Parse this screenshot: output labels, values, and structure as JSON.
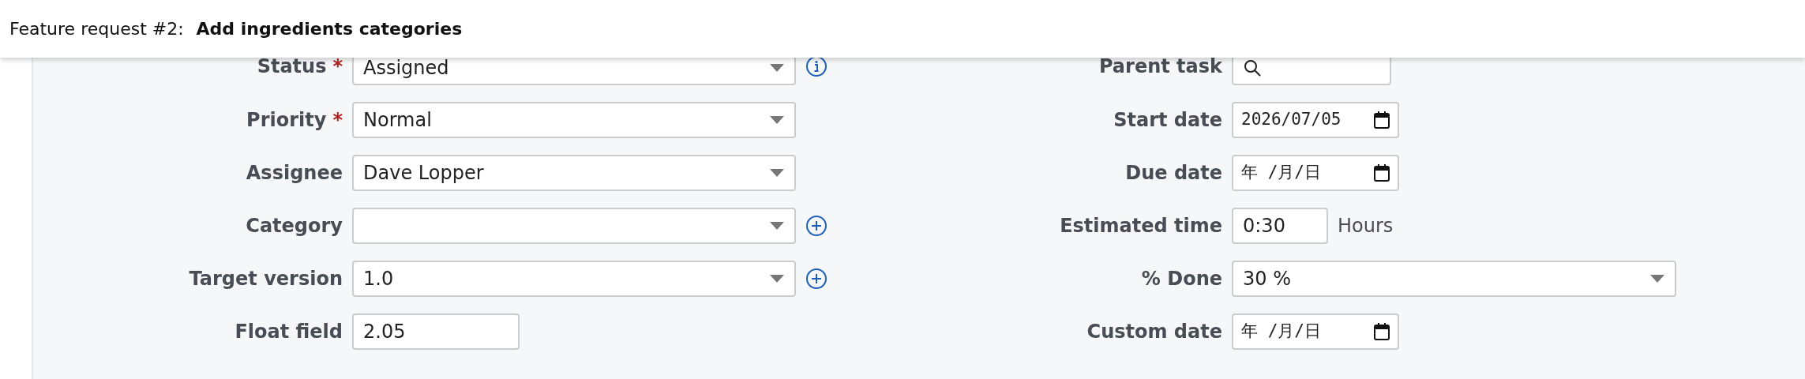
{
  "header": {
    "prefix": "Feature request #2:",
    "title": "Add ingredients categories"
  },
  "left_fields": [
    {
      "label": "Status",
      "required_mark": "*",
      "kind": "select",
      "value": "Assigned",
      "info": true
    },
    {
      "label": "Priority",
      "required_mark": "*",
      "kind": "select",
      "value": "Normal"
    },
    {
      "label": "Assignee",
      "kind": "select",
      "value": "Dave Lopper"
    },
    {
      "label": "Category",
      "kind": "select",
      "addable": true
    },
    {
      "label": "Target version",
      "kind": "select",
      "value": "1.0",
      "addable": true
    },
    {
      "label": "Float field",
      "kind": "text",
      "value": "2.05"
    }
  ],
  "right_fields": [
    {
      "label": "Parent task",
      "kind": "search"
    },
    {
      "label": "Start date",
      "kind": "date",
      "value": "2026/07/05"
    },
    {
      "label": "Due date",
      "kind": "date",
      "value": "年 /月/日"
    },
    {
      "label": "Estimated time",
      "kind": "text",
      "value": "0:30",
      "unit": "Hours"
    },
    {
      "label": "% Done",
      "kind": "select",
      "value": "30 %"
    },
    {
      "label": "Custom date",
      "kind": "date",
      "value": "年 /月/日"
    }
  ]
}
